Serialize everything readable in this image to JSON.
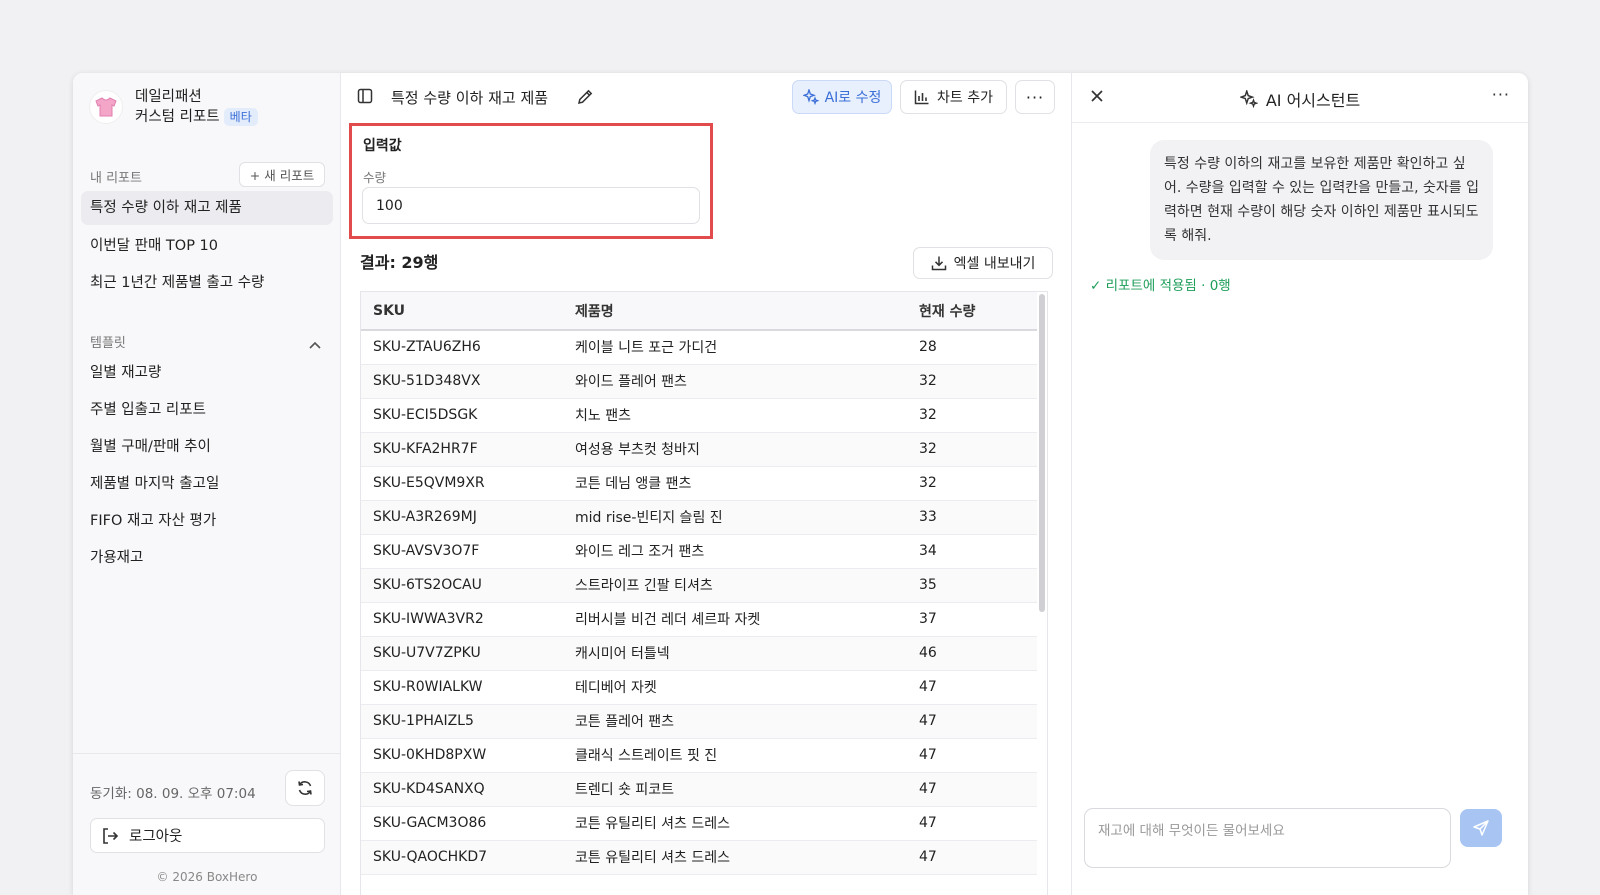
{
  "sidebar": {
    "brand_line1": "데일리패션",
    "brand_line2": "커스텀 리포트",
    "badge": "베타",
    "my_reports_heading": "내 리포트",
    "new_report_label": "+ 새 리포트",
    "my_reports": [
      {
        "label": "특정 수량 이하 재고 제품",
        "active": true
      },
      {
        "label": "이번달 판매 TOP 10",
        "active": false
      },
      {
        "label": "최근 1년간 제품별 출고 수량",
        "active": false
      }
    ],
    "templates_heading": "템플릿",
    "templates": [
      "일별 재고량",
      "주별 입출고 리포트",
      "월별 구매/판매 추이",
      "제품별 마지막 출고일",
      "FIFO 재고 자산 평가",
      "가용재고"
    ],
    "sync_text": "동기화: 08. 09. 오후 07:04",
    "logout_label": "로그아웃",
    "copyright": "© 2026 BoxHero"
  },
  "toolbar": {
    "report_title": "특정 수량 이하 재고 제품",
    "ai_edit_label": "AI로 수정",
    "add_chart_label": "차트 추가",
    "more_label": "···"
  },
  "input_card": {
    "title": "입력값",
    "field_label": "수량",
    "field_value": "100"
  },
  "result": {
    "title": "결과: 29행",
    "export_label": "엑셀 내보내기",
    "columns": [
      "SKU",
      "제품명",
      "현재 수량"
    ],
    "rows": [
      [
        "SKU-ZTAU6ZH6",
        "케이블 니트 포근 가디건",
        "28"
      ],
      [
        "SKU-51D348VX",
        "와이드 플레어 팬츠",
        "32"
      ],
      [
        "SKU-ECI5DSGK",
        "치노 팬츠",
        "32"
      ],
      [
        "SKU-KFA2HR7F",
        "여성용 부츠컷 청바지",
        "32"
      ],
      [
        "SKU-E5QVM9XR",
        "코튼 데님 앵클 팬츠",
        "32"
      ],
      [
        "SKU-A3R269MJ",
        "mid rise-빈티지 슬림 진",
        "33"
      ],
      [
        "SKU-AVSV3O7F",
        "와이드 레그 조거 팬츠",
        "34"
      ],
      [
        "SKU-6TS2OCAU",
        "스트라이프 긴팔 티셔츠",
        "35"
      ],
      [
        "SKU-IWWA3VR2",
        "리버시블 비건 레더 셰르파 자켓",
        "37"
      ],
      [
        "SKU-U7V7ZPKU",
        "캐시미어 터틀넥",
        "46"
      ],
      [
        "SKU-R0WIALKW",
        "테디베어 자켓",
        "47"
      ],
      [
        "SKU-1PHAIZL5",
        "코튼 플레어 팬츠",
        "47"
      ],
      [
        "SKU-0KHD8PXW",
        "클래식 스트레이트 핏 진",
        "47"
      ],
      [
        "SKU-KD4SANXQ",
        "트렌디 숏 피코트",
        "47"
      ],
      [
        "SKU-GACM3O86",
        "코튼 유틸리티 셔츠 드레스",
        "47"
      ],
      [
        "SKU-QAOCHKD7",
        "코튼 유틸리티 셔츠 드레스",
        "47"
      ]
    ]
  },
  "ai_panel": {
    "title": "AI 어시스턴트",
    "more_label": "···",
    "user_message": "특정 수량 이하의 재고를 보유한 제품만 확인하고 싶어. 수량을 입력할 수 있는 입력칸을 만들고, 숫자를 입력하면 현재 수량이 해당 숫자 이하인 제품만 표시되도록 해줘.",
    "applied_status": "✓ 리포트에 적용됨 · 0행",
    "chat_placeholder": "재고에 대해 무엇이든 물어보세요"
  },
  "colors": {
    "accent": "#3b6fd8",
    "highlight_border": "#e24b4b",
    "success": "#1e9e5a"
  }
}
